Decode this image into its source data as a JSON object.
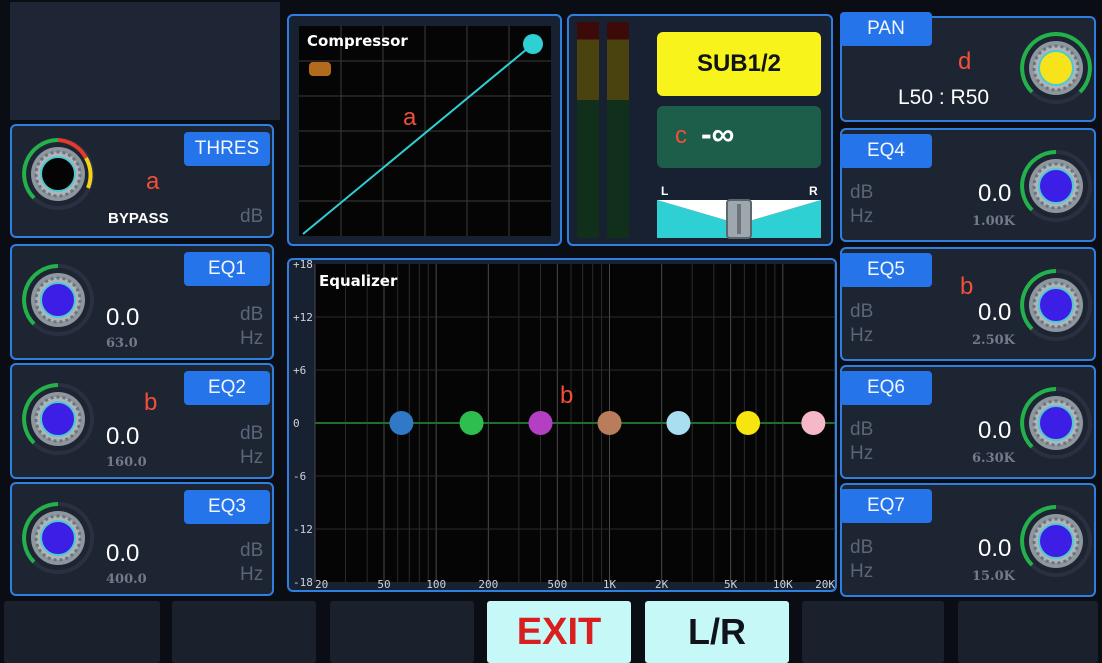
{
  "annotations": {
    "a": "a",
    "b": "b",
    "c": "c",
    "d": "d"
  },
  "compressor": {
    "title": "Compressor",
    "threshold_label": "THRES",
    "bypass_label": "BYPASS",
    "unit": "dB"
  },
  "eq_left": [
    {
      "label": "EQ1",
      "value": "0.0",
      "db": "dB",
      "hz": "Hz",
      "freq": "63.0"
    },
    {
      "label": "EQ2",
      "value": "0.0",
      "db": "dB",
      "hz": "Hz",
      "freq": "160.0"
    },
    {
      "label": "EQ3",
      "value": "0.0",
      "db": "dB",
      "hz": "Hz",
      "freq": "400.0"
    }
  ],
  "eq_right": [
    {
      "label": "EQ4",
      "value": "0.0",
      "db": "dB",
      "hz": "Hz",
      "freq": "1.00K"
    },
    {
      "label": "EQ5",
      "value": "0.0",
      "db": "dB",
      "hz": "Hz",
      "freq": "2.50K"
    },
    {
      "label": "EQ6",
      "value": "0.0",
      "db": "dB",
      "hz": "Hz",
      "freq": "6.30K"
    },
    {
      "label": "EQ7",
      "value": "0.0",
      "db": "dB",
      "hz": "Hz",
      "freq": "15.0K"
    }
  ],
  "output": {
    "bus_label": "SUB1/2",
    "level": "-∞",
    "balance_left": "L",
    "balance_right": "R"
  },
  "pan": {
    "label": "PAN",
    "value": "L50 : R50"
  },
  "equalizer": {
    "title": "Equalizer",
    "y_ticks": [
      "+18",
      "+12",
      "+6",
      "0",
      "-6",
      "-12",
      "-18"
    ],
    "x_ticks": [
      "20",
      "50",
      "100",
      "200",
      "500",
      "1K",
      "2K",
      "5K",
      "10K",
      "20K"
    ],
    "points": [
      {
        "freq": 63,
        "gain": 0,
        "color": "#2f79c6"
      },
      {
        "freq": 160,
        "gain": 0,
        "color": "#2dbe4e"
      },
      {
        "freq": 400,
        "gain": 0,
        "color": "#b43fc3"
      },
      {
        "freq": 1000,
        "gain": 0,
        "color": "#b97d5c"
      },
      {
        "freq": 2500,
        "gain": 0,
        "color": "#a9def0"
      },
      {
        "freq": 6300,
        "gain": 0,
        "color": "#f7e50f"
      },
      {
        "freq": 15000,
        "gain": 0,
        "color": "#f6b7c6"
      }
    ]
  },
  "bottom": {
    "exit_label": "EXIT",
    "lr_label": "L/R"
  },
  "colors": {
    "accent_blue": "#2f7fe0",
    "curve_cyan": "#2fd0d4",
    "bus_yellow": "#f7f31b",
    "level_green": "#1d5e4a",
    "exit_red": "#d81e1e",
    "button_cyan": "#c7f8f8"
  }
}
